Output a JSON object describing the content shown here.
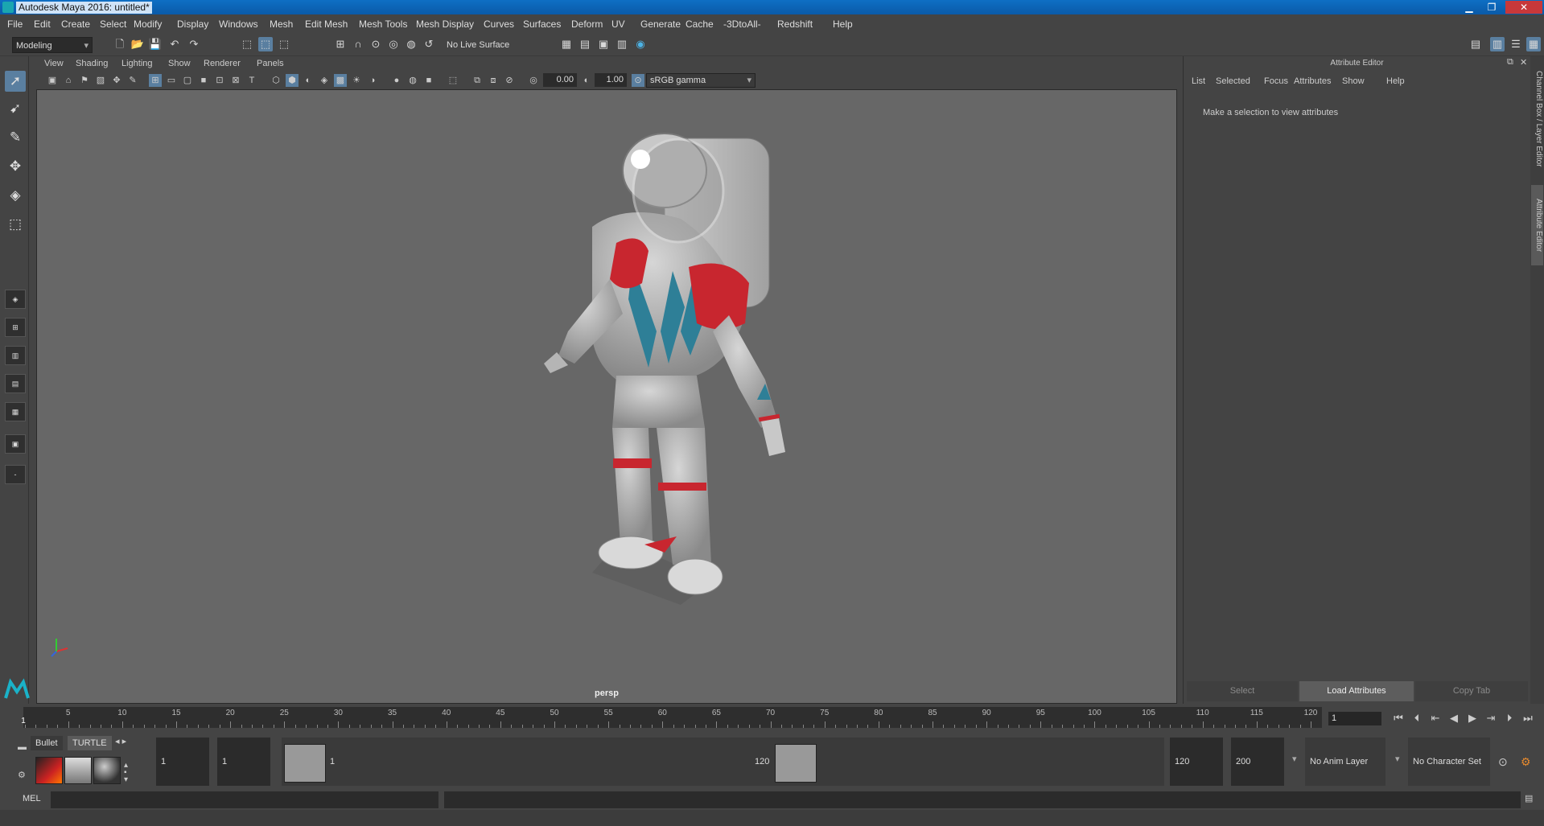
{
  "window": {
    "title": "Autodesk Maya 2016: untitled*",
    "min": "▁",
    "max": "❐",
    "close": "✕"
  },
  "menubar": [
    "File",
    "Edit",
    "Create",
    "Select",
    "Modify",
    "Display",
    "Windows",
    "Mesh",
    "Edit Mesh",
    "Mesh Tools",
    "Mesh Display",
    "Curves",
    "Surfaces",
    "Deform",
    "UV",
    "Generate",
    "Cache",
    "-3DtoAll-",
    "Redshift",
    "Help"
  ],
  "shelf": {
    "mode": "Modeling",
    "live_surface": "No Live Surface"
  },
  "panel_menu": [
    "View",
    "Shading",
    "Lighting",
    "Show",
    "Renderer",
    "Panels"
  ],
  "panel_toolbar": {
    "exposure": "0.00",
    "gamma": "1.00",
    "colorspace": "sRGB gamma"
  },
  "viewport": {
    "camera": "persp"
  },
  "attribute_editor": {
    "title": "Attribute Editor",
    "menu": [
      "List",
      "Selected",
      "Focus",
      "Attributes",
      "Show",
      "Help"
    ],
    "message": "Make a selection to view attributes",
    "buttons": [
      "Select",
      "Load Attributes",
      "Copy Tab"
    ]
  },
  "side_tabs": [
    "Channel Box / Layer Editor",
    "Attribute Editor"
  ],
  "timeline": {
    "ticks": [
      "5",
      "10",
      "15",
      "20",
      "25",
      "30",
      "35",
      "40",
      "45",
      "50",
      "55",
      "60",
      "65",
      "70",
      "75",
      "80",
      "85",
      "90",
      "95",
      "100",
      "105",
      "110",
      "115",
      "120"
    ],
    "start_label": "1",
    "current_frame": "1"
  },
  "range": {
    "shelf_tabs": [
      "Bullet",
      "TURTLE"
    ],
    "start": "1",
    "playback_start": "1",
    "slider_start": "1",
    "slider_end": "120",
    "playback_end": "120",
    "end": "200",
    "anim_layer": "No Anim Layer",
    "character_set": "No Character Set"
  },
  "command": {
    "label": "MEL"
  },
  "colors": {
    "accent": "#5a7fa0",
    "viewport_bg": "#676767",
    "suit_red": "#c8262f",
    "suit_teal": "#2e7f97"
  }
}
